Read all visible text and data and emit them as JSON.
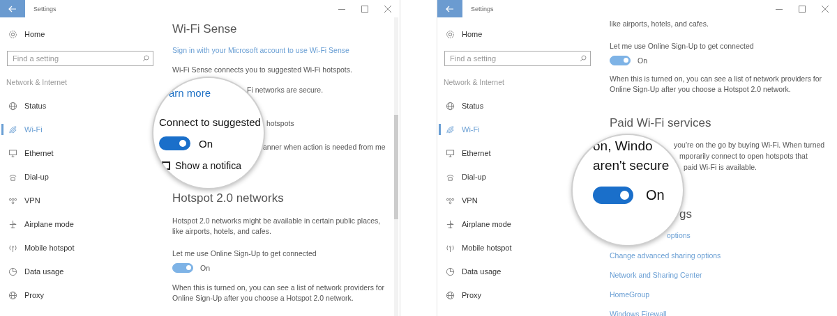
{
  "windows": [
    {
      "title": "Settings",
      "home": "Home",
      "search_placeholder": "Find a setting",
      "section": "Network & Internet",
      "nav": [
        {
          "label": "Status",
          "selected": false
        },
        {
          "label": "Wi-Fi",
          "selected": true
        },
        {
          "label": "Ethernet",
          "selected": false
        },
        {
          "label": "Dial-up",
          "selected": false
        },
        {
          "label": "VPN",
          "selected": false
        },
        {
          "label": "Airplane mode",
          "selected": false
        },
        {
          "label": "Mobile hotspot",
          "selected": false
        },
        {
          "label": "Data usage",
          "selected": false
        },
        {
          "label": "Proxy",
          "selected": false
        }
      ],
      "content": [
        {
          "kind": "heading",
          "text": "Wi-Fi Sense"
        },
        {
          "kind": "link",
          "text": "Sign in with your Microsoft account to use Wi-Fi Sense"
        },
        {
          "kind": "text",
          "text": "Wi-Fi Sense connects you to suggested Wi-Fi hotspots."
        },
        {
          "kind": "text",
          "text": "Fi networks are secure."
        },
        {
          "kind": "text",
          "text": "hotspots"
        },
        {
          "kind": "text",
          "text": "anner when action is needed from me"
        },
        {
          "kind": "heading",
          "text": "Hotspot 2.0 networks"
        },
        {
          "kind": "para",
          "text": "Hotspot 2.0 networks might be available in certain public places, like airports, hotels, and cafes."
        },
        {
          "kind": "text",
          "text": "Let me use Online Sign-Up to get connected"
        },
        {
          "kind": "toggle",
          "on": true,
          "state_label": "On"
        },
        {
          "kind": "para",
          "text": "When this is turned on, you can see a list of network providers for Online Sign-Up after you choose a Hotspot 2.0 network."
        }
      ],
      "magnifier": [
        {
          "kind": "link",
          "text": "arn more"
        },
        {
          "kind": "text",
          "text": "Connect to suggested"
        },
        {
          "kind": "toggle",
          "on": true,
          "state_label": "On"
        },
        {
          "kind": "checkbox",
          "checked": false,
          "text": "Show a notifica"
        }
      ]
    },
    {
      "title": "Settings",
      "home": "Home",
      "search_placeholder": "Find a setting",
      "section": "Network & Internet",
      "nav": [
        {
          "label": "Status",
          "selected": false
        },
        {
          "label": "Wi-Fi",
          "selected": true
        },
        {
          "label": "Ethernet",
          "selected": false
        },
        {
          "label": "Dial-up",
          "selected": false
        },
        {
          "label": "VPN",
          "selected": false
        },
        {
          "label": "Airplane mode",
          "selected": false
        },
        {
          "label": "Mobile hotspot",
          "selected": false
        },
        {
          "label": "Data usage",
          "selected": false
        },
        {
          "label": "Proxy",
          "selected": false
        }
      ],
      "content": [
        {
          "kind": "text",
          "text": "like airports, hotels, and cafes."
        },
        {
          "kind": "text",
          "text": "Let me use Online Sign-Up to get connected"
        },
        {
          "kind": "toggle",
          "on": true,
          "state_label": "On"
        },
        {
          "kind": "para",
          "text": "When this is turned on, you can see a list of network providers for Online Sign-Up after you choose a Hotspot 2.0 network."
        },
        {
          "kind": "heading",
          "text": "Paid Wi-Fi services"
        },
        {
          "kind": "text",
          "text": "you're on the go by buying Wi-Fi. When turned"
        },
        {
          "kind": "text",
          "text": "mporarily connect to open hotspots that"
        },
        {
          "kind": "text",
          "text": "paid Wi-Fi is available."
        },
        {
          "kind": "heading",
          "text": "gs"
        },
        {
          "kind": "link",
          "text": "options"
        },
        {
          "kind": "link",
          "text": "Change advanced sharing options"
        },
        {
          "kind": "link",
          "text": "Network and Sharing Center"
        },
        {
          "kind": "link",
          "text": "HomeGroup"
        },
        {
          "kind": "link",
          "text": "Windows Firewall"
        }
      ],
      "magnifier": [
        {
          "kind": "text",
          "text": "on, Windo"
        },
        {
          "kind": "text",
          "text": "aren't secure"
        },
        {
          "kind": "toggle",
          "on": true,
          "state_label": "On"
        }
      ]
    }
  ]
}
